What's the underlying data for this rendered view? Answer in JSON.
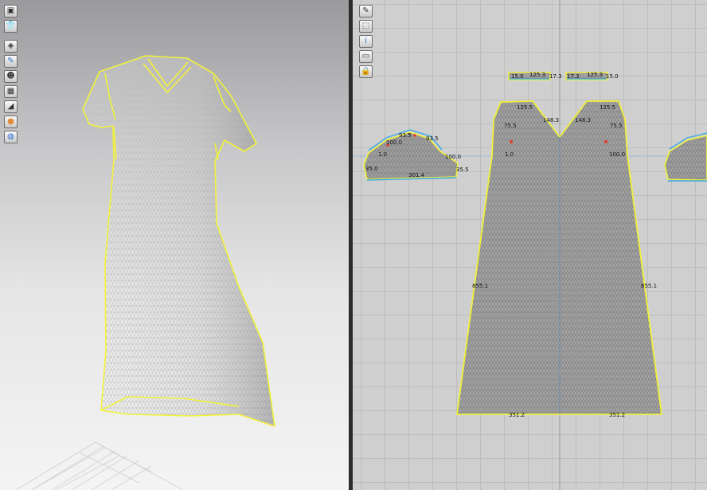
{
  "toolbar3d": {
    "icons": [
      "select-mesh-icon",
      "garment-icon",
      "fold-icon",
      "brush-icon",
      "avatar-pose-icon",
      "texture-icon",
      "iron-icon",
      "avatar-icon",
      "globe-icon"
    ]
  },
  "toolbar2d": {
    "icons": [
      "edit-pattern-icon",
      "transform-pattern-icon",
      "info-icon",
      "segment-icon",
      "lock-icon"
    ]
  },
  "pattern_labels": {
    "neck_binding_left": [
      "15.0",
      "125.3",
      "17.3"
    ],
    "neck_binding_right": [
      "17.3",
      "125.3",
      "15.0"
    ],
    "front_shoulder_left": "125.5",
    "front_shoulder_right": "125.5",
    "front_neck_left": "148.3",
    "front_neck_right": "148.3",
    "front_arm_left": "75.5",
    "front_arm_right": "75.5",
    "front_side_left": "855.1",
    "front_side_right": "855.1",
    "front_hem_left": "351.2",
    "front_hem_right": "351.2",
    "front_mark_left": "1.0",
    "front_mark_right": "100.0",
    "sleeve_top_a": "93.5",
    "sleeve_top_b": "93.5",
    "sleeve_left_mark": "100.0",
    "sleeve_right_mark": "100.0",
    "sleeve_cuff": "301.4",
    "sleeve_side_a": "35.0",
    "sleeve_side_b": "35.5",
    "sleeve_tag": "1.0"
  },
  "colors": {
    "seam_yellow": "#f2f23a",
    "binding_blue": "#39a8e6",
    "notch_red": "#e23a2a",
    "fabric_gray": "#9a9a9a"
  }
}
